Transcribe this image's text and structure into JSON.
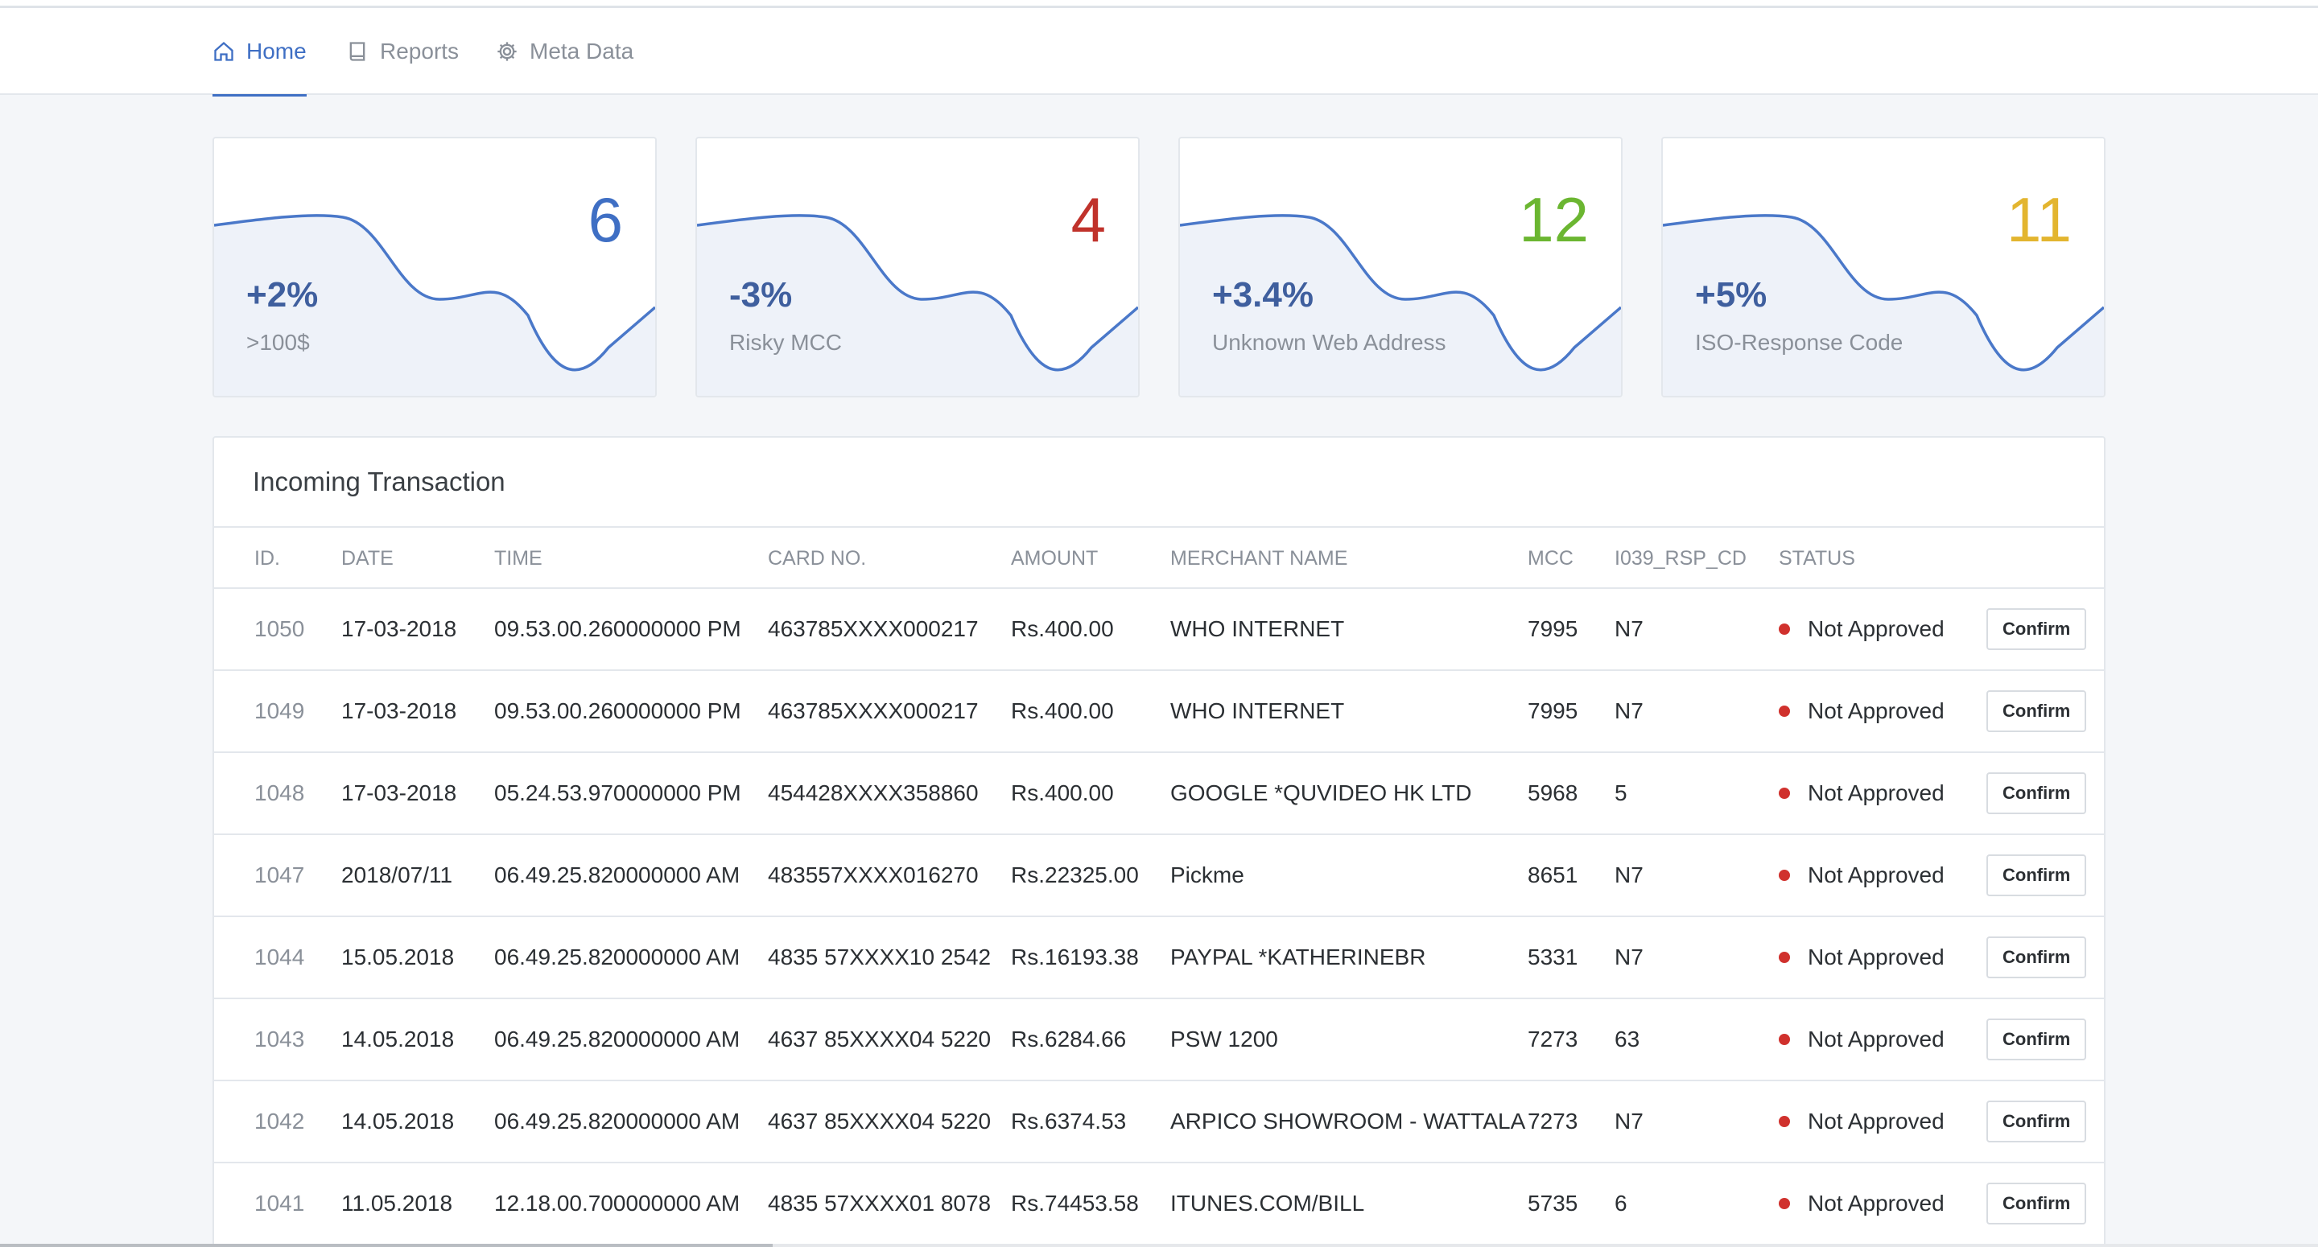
{
  "nav": {
    "items": [
      {
        "label": "Home",
        "icon": "home-icon",
        "active": true
      },
      {
        "label": "Reports",
        "icon": "book-icon",
        "active": false
      },
      {
        "label": "Meta Data",
        "icon": "gear-icon",
        "active": false
      }
    ]
  },
  "cards": [
    {
      "count": "6",
      "pct": "+2%",
      "label": ">100$",
      "color": "#3f6fc4"
    },
    {
      "count": "4",
      "pct": "-3%",
      "label": "Risky MCC",
      "color": "#c0322b"
    },
    {
      "count": "12",
      "pct": "+3.4%",
      "label": "Unknown Web Address",
      "color": "#6bb631"
    },
    {
      "count": "11",
      "pct": "+5%",
      "label": "ISO-Response Code",
      "color": "#e3b52f"
    }
  ],
  "table": {
    "title": "Incoming Transaction",
    "columns": [
      "ID.",
      "DATE",
      "TIME",
      "CARD NO.",
      "AMOUNT",
      "MERCHANT NAME",
      "MCC",
      "I039_RSP_CD",
      "STATUS"
    ],
    "confirm_label": "Confirm",
    "rows": [
      {
        "id": "1050",
        "date": "17-03-2018",
        "time": "09.53.00.260000000 PM",
        "card": "463785XXXX000217",
        "amount": "Rs.400.00",
        "merchant": "WHO INTERNET",
        "mcc": "7995",
        "rsp": "N7",
        "status": "Not Approved"
      },
      {
        "id": "1049",
        "date": "17-03-2018",
        "time": "09.53.00.260000000 PM",
        "card": "463785XXXX000217",
        "amount": "Rs.400.00",
        "merchant": "WHO INTERNET",
        "mcc": "7995",
        "rsp": "N7",
        "status": "Not Approved"
      },
      {
        "id": "1048",
        "date": "17-03-2018",
        "time": "05.24.53.970000000 PM",
        "card": "454428XXXX358860",
        "amount": "Rs.400.00",
        "merchant": "GOOGLE *QUVIDEO HK LTD",
        "mcc": "5968",
        "rsp": "5",
        "status": "Not Approved"
      },
      {
        "id": "1047",
        "date": "2018/07/11",
        "time": "06.49.25.820000000 AM",
        "card": "483557XXXX016270",
        "amount": "Rs.22325.00",
        "merchant": "Pickme",
        "mcc": "8651",
        "rsp": "N7",
        "status": "Not Approved"
      },
      {
        "id": "1044",
        "date": "15.05.2018",
        "time": "06.49.25.820000000 AM",
        "card": "4835 57XXXX10 2542",
        "amount": "Rs.16193.38",
        "merchant": "PAYPAL *KATHERINEBR",
        "mcc": "5331",
        "rsp": "N7",
        "status": "Not Approved"
      },
      {
        "id": "1043",
        "date": "14.05.2018",
        "time": "06.49.25.820000000 AM",
        "card": "4637 85XXXX04 5220",
        "amount": "Rs.6284.66",
        "merchant": "PSW 1200",
        "mcc": "7273",
        "rsp": "63",
        "status": "Not Approved"
      },
      {
        "id": "1042",
        "date": "14.05.2018",
        "time": "06.49.25.820000000 AM",
        "card": "4637 85XXXX04 5220",
        "amount": "Rs.6374.53",
        "merchant": "ARPICO SHOWROOM - WATTALA",
        "mcc": "7273",
        "rsp": "N7",
        "status": "Not Approved"
      },
      {
        "id": "1041",
        "date": "11.05.2018",
        "time": "12.18.00.700000000 AM",
        "card": "4835 57XXXX01 8078",
        "amount": "Rs.74453.58",
        "merchant": "ITUNES.COM/BILL",
        "mcc": "5735",
        "rsp": "6",
        "status": "Not Approved"
      }
    ]
  }
}
